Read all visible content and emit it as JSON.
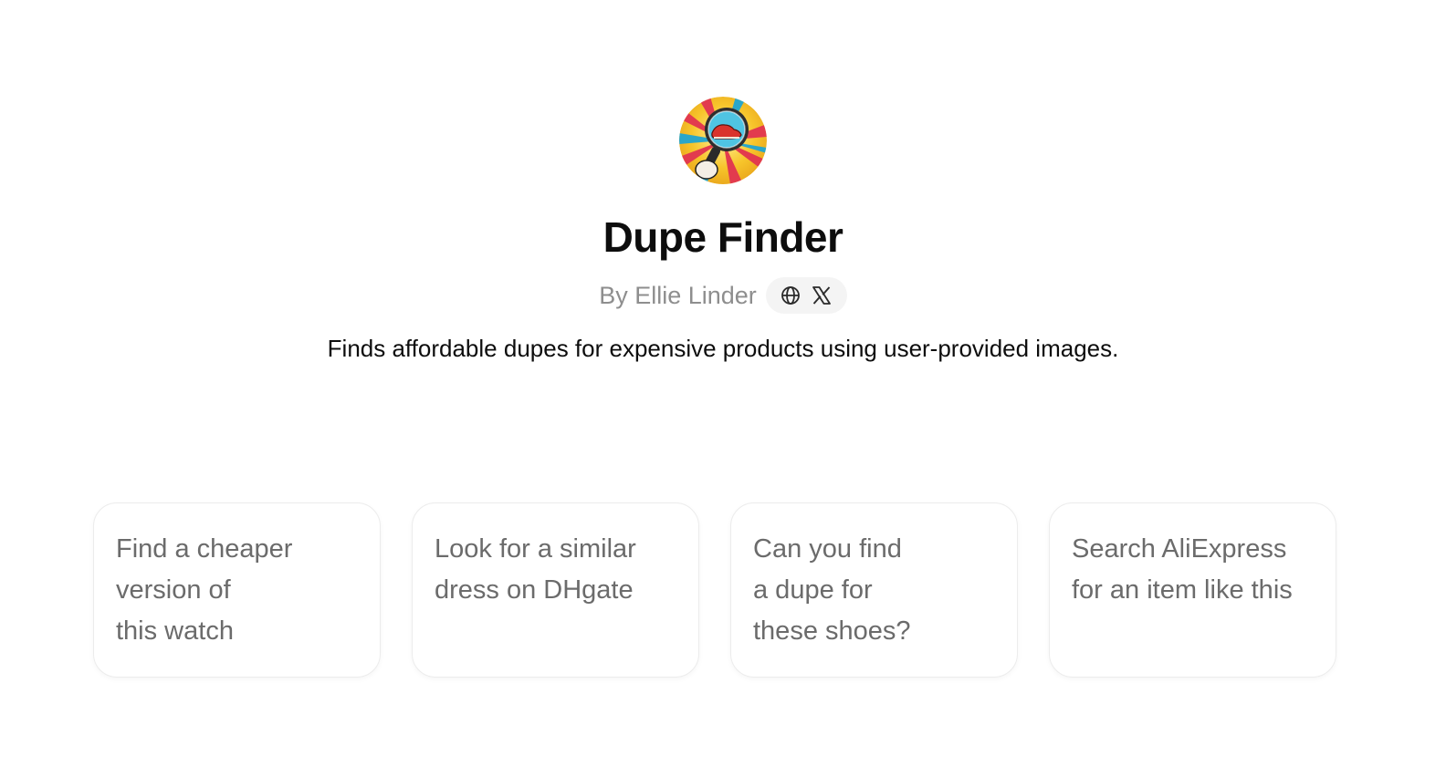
{
  "gpt": {
    "avatar_icon": "magnifying-glass-shoe-avatar",
    "title": "Dupe Finder",
    "byline": "By Ellie Linder",
    "social_icons": [
      "globe-icon",
      "x-icon"
    ],
    "description": "Finds affordable dupes for expensive products using user-provided images."
  },
  "prompts": [
    {
      "lines": [
        "Find a cheaper",
        "version of",
        "this watch"
      ]
    },
    {
      "lines": [
        "Look for a similar",
        "dress on DHgate"
      ]
    },
    {
      "lines": [
        "Can you find",
        "a dupe for",
        "these shoes?"
      ]
    },
    {
      "lines": [
        "Search AliExpress",
        "for an item like this"
      ]
    }
  ],
  "colors": {
    "title": "#0d0d0d",
    "muted": "#8e8e8e",
    "card_text": "#6b6b6b",
    "card_border": "#ececec",
    "pill_bg": "#f4f4f4"
  }
}
